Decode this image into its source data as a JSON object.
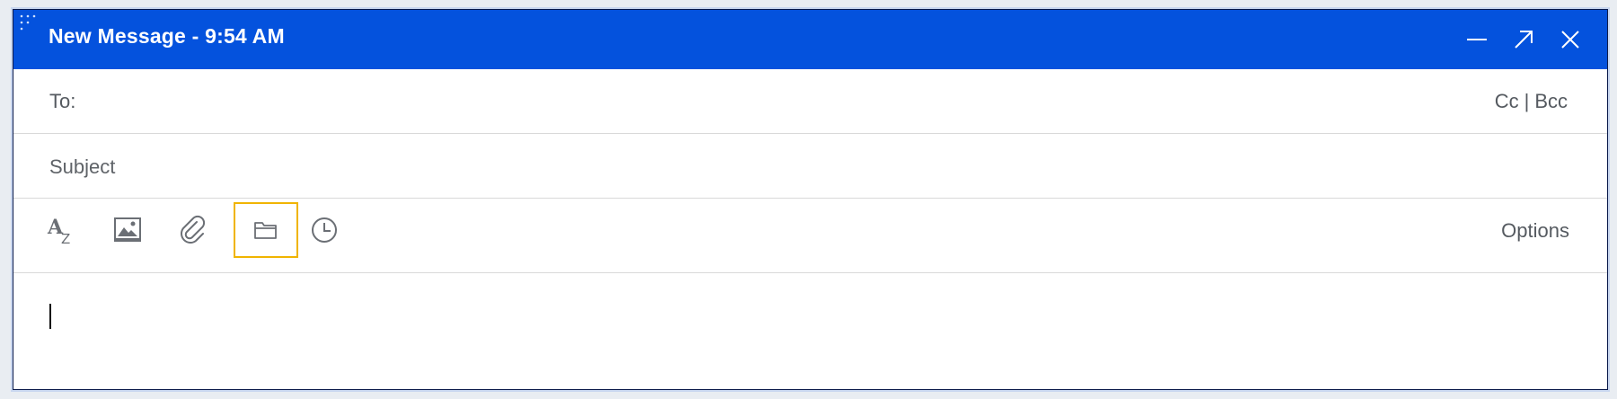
{
  "window": {
    "title": "New Message - 9:54 AM",
    "accent_color": "#0452dd",
    "controls": {
      "minimize_icon": "minimize-icon",
      "expand_icon": "expand-icon",
      "close_icon": "close-icon"
    }
  },
  "to": {
    "label": "To:",
    "value": "",
    "cc_label": "Cc",
    "separator": "|",
    "bcc_label": "Bcc"
  },
  "subject": {
    "placeholder": "Subject",
    "value": ""
  },
  "toolbar": {
    "tools": [
      {
        "icon": "text-format-icon"
      },
      {
        "icon": "insert-image-icon"
      },
      {
        "icon": "paperclip-icon"
      },
      {
        "icon": "folder-icon",
        "focused": true
      },
      {
        "icon": "clock-icon"
      }
    ],
    "focus_color": "#f0b400",
    "options_label": "Options"
  },
  "body": {
    "value": ""
  }
}
